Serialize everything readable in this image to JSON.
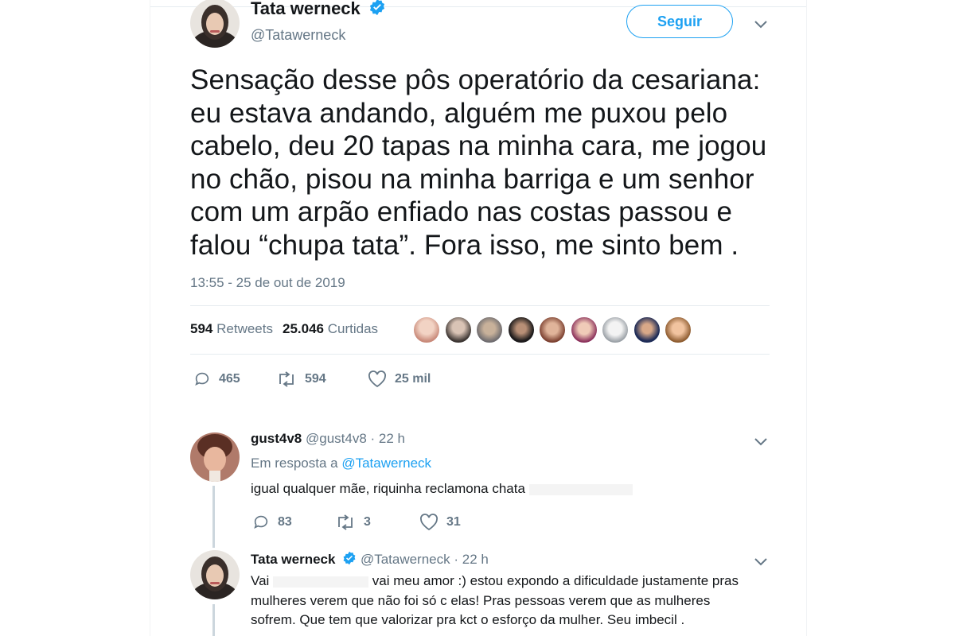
{
  "main_tweet": {
    "author_name": "Tata werneck",
    "author_handle": "@Tatawerneck",
    "follow_label": "Seguir",
    "text": "Sensação desse pôs operatório da cesariana: eu estava andando, alguém me puxou pelo cabelo, deu 20 tapas na minha cara, me jogou no chão, pisou na minha barriga e um senhor com um arpão enfiado nas costas passou e falou “chupa tata”. Fora isso, me sinto bem .",
    "timestamp": "13:55 - 25 de out de 2019",
    "retweets_count": "594",
    "retweets_label": "Retweets",
    "likes_count": "25.046",
    "likes_label": "Curtidas",
    "action_replies": "465",
    "action_retweets": "594",
    "action_likes": "25 mil"
  },
  "reply1": {
    "name": "gust4v8",
    "handle": "@gust4v8",
    "time": "· 22 h",
    "in_reply_prefix": "Em resposta a",
    "in_reply_to": "@Tatawerneck",
    "text": "igual qualquer mãe, riquinha reclamona chata",
    "action_replies": "83",
    "action_retweets": "3",
    "action_likes": "31"
  },
  "reply2": {
    "name": "Tata werneck",
    "handle": "@Tatawerneck",
    "time": "· 22 h",
    "text_start": "Vai",
    "text_rest": "vai meu amor :) estou expondo a dificuldade justamente pras",
    "text_line2": "mulheres verem que não foi só c elas! Pras pessoas verem que as mulheres",
    "text_line3": "sofrem. Que tem que valorizar pra kct o esforço da mulher. Seu imbecil ."
  },
  "colors": {
    "accent": "#1da1f2",
    "muted": "#657786",
    "text": "#14171a"
  }
}
